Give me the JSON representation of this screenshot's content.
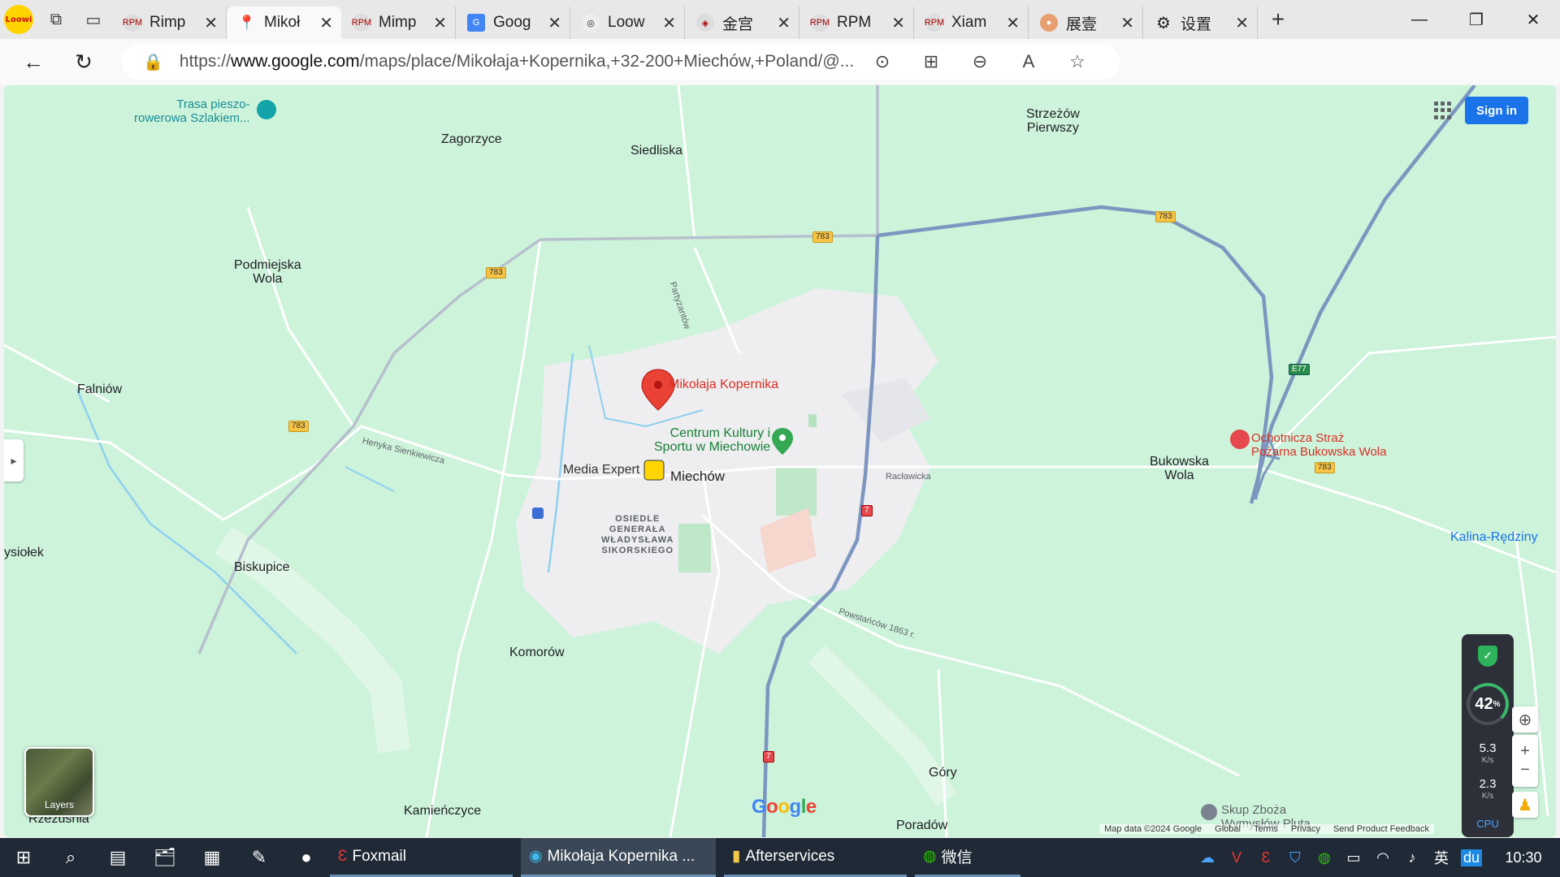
{
  "browser": {
    "tabs": [
      {
        "title": "Rimp",
        "active": false
      },
      {
        "title": "Mikoł",
        "active": true
      },
      {
        "title": "Mimp",
        "active": false
      },
      {
        "title": "Goog",
        "active": false
      },
      {
        "title": "Loow",
        "active": false
      },
      {
        "title": "金宫",
        "active": false
      },
      {
        "title": "RPM",
        "active": false
      },
      {
        "title": "Xiam",
        "active": false
      },
      {
        "title": "展壹",
        "active": false
      },
      {
        "title": "设置",
        "active": false
      }
    ],
    "url_prefix": "https://",
    "url_host": "www.google.com",
    "url_path": "/maps/place/Mikołaja+Kopernika,+32-200+Miechów,+Poland/@..."
  },
  "map": {
    "signin_label": "Sign in",
    "layers_label": "Layers",
    "logo": "Google",
    "attribution": [
      "Map data ©2024 Google",
      "Global",
      "Terms",
      "Privacy",
      "Send Product Feedback"
    ],
    "places": {
      "zagorzyce": "Zagorzyce",
      "siedliska": "Siedliska",
      "strzezow": "Strzeżów\nPierwszy",
      "podmiejska": "Podmiejska\nWola",
      "falniow": "Falniów",
      "biskupice": "Biskupice",
      "komorow": "Komorów",
      "kamienczyce": "Kamieńczyce",
      "rzezusnia": "Rzezuśnia",
      "gory": "Góry",
      "poradow": "Poradów",
      "bukowska": "Bukowska\nWola",
      "kalina": "Kalina-Rędziny",
      "miechow": "Miechów",
      "osiedle": "OSIEDLE\nGENERAŁA\nWŁADYSŁAWA\nSIKORSKIEGO",
      "ysiolek": "ysiołek",
      "trasa": "Trasa pieszo-\nrowerowa Szlakiem...",
      "pin": "Mikołaja Kopernika",
      "centrum": "Centrum Kultury i\nSportu w Miechowie",
      "media": "Media Expert",
      "straz": "Ochotnicza Straż\nPożarna Bukowska Wola",
      "skup": "Skup Zboża\nWymysłów Pluta"
    },
    "streets": {
      "partyzantow": "Partyzantów",
      "sienkiewicza": "Henyka Sienkiewicza",
      "raclawicka": "Racławicka",
      "powstancow": "Powstańców 1863 r."
    },
    "shields": {
      "r783": "783",
      "r7": "7",
      "e77": "E77"
    },
    "perf": {
      "pct": "42",
      "pct_unit": "%",
      "up": "5.3",
      "down": "2.3",
      "unit": "K/s",
      "label": "CPU"
    }
  },
  "taskbar": {
    "apps": [
      "Foxmail",
      "Mikołaja Kopernika ...",
      "Afterservices",
      "微信"
    ],
    "ime": "英",
    "time": "10:30"
  },
  "colors": {
    "map_bg": "#cdf3db",
    "pin": "#ea4335",
    "signin": "#1a73e8"
  }
}
